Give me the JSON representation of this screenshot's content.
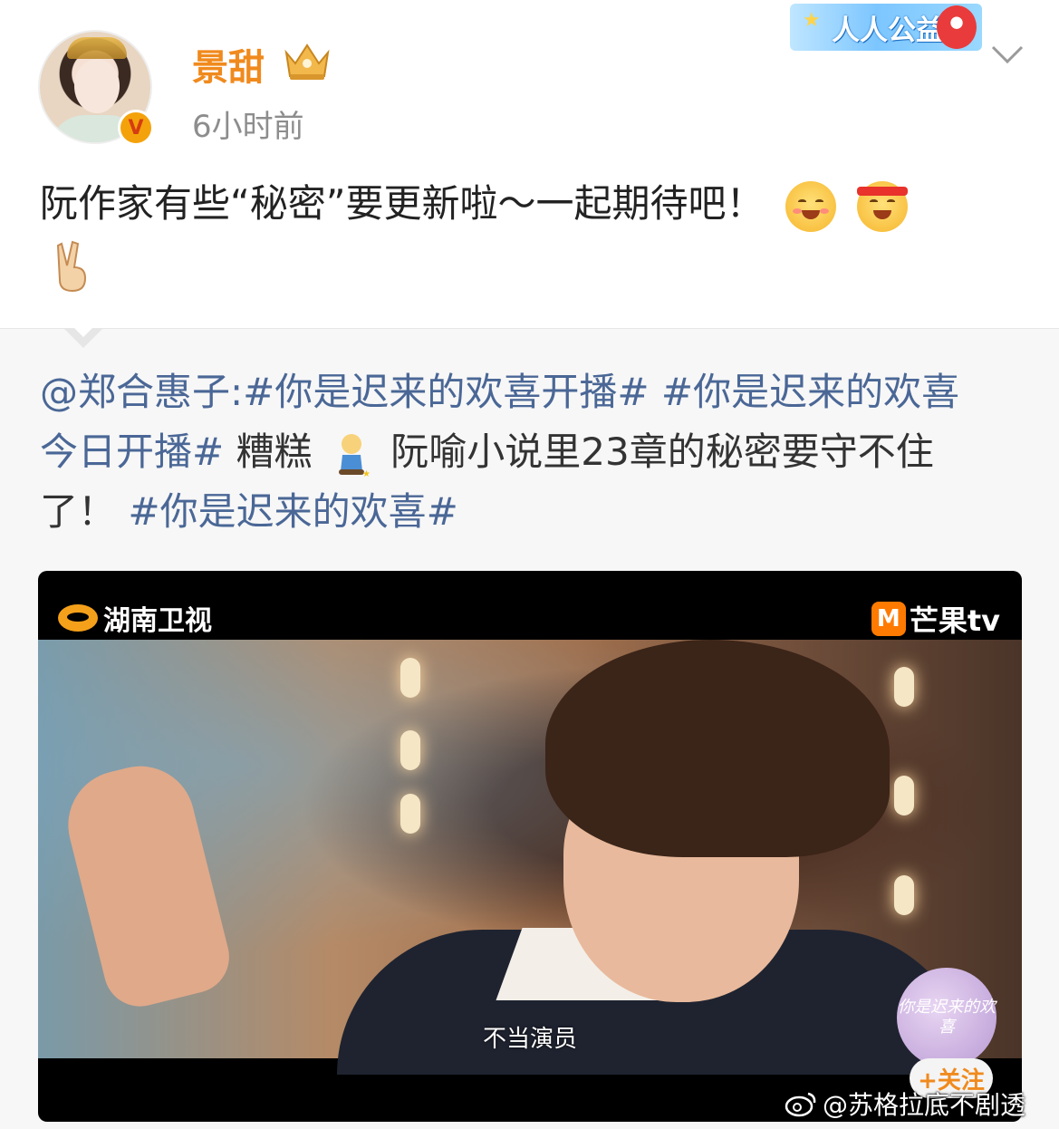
{
  "post": {
    "username": "景甜",
    "timestamp": "6小时前",
    "text": "阮作家有些“秘密”要更新啦～一起期待吧！",
    "charity_badge": "人人公益",
    "verified": "V"
  },
  "repost": {
    "mention": "@郑合惠子:",
    "hashtag_1": "#你是迟来的欢喜开播#",
    "hashtag_2a": "#你是迟来的欢喜",
    "hashtag_2b": "今日开播#",
    "word": "糟糕",
    "text_mid": "阮喻小说里23章的秘密要守不住",
    "text_end": "了！",
    "hashtag_3": "#你是迟来的欢喜#"
  },
  "video": {
    "channel_logo": "湖南卫视",
    "platform_logo": "芒果tv",
    "platform_icon": "M",
    "subtitle": "不当演员",
    "show_badge": "你是迟来的欢喜",
    "follow_label": "+关注"
  },
  "watermark": "@苏格拉底不剧透",
  "colors": {
    "username": "#f08a1d",
    "link": "#4a6796",
    "verified": "#f4a20b"
  }
}
